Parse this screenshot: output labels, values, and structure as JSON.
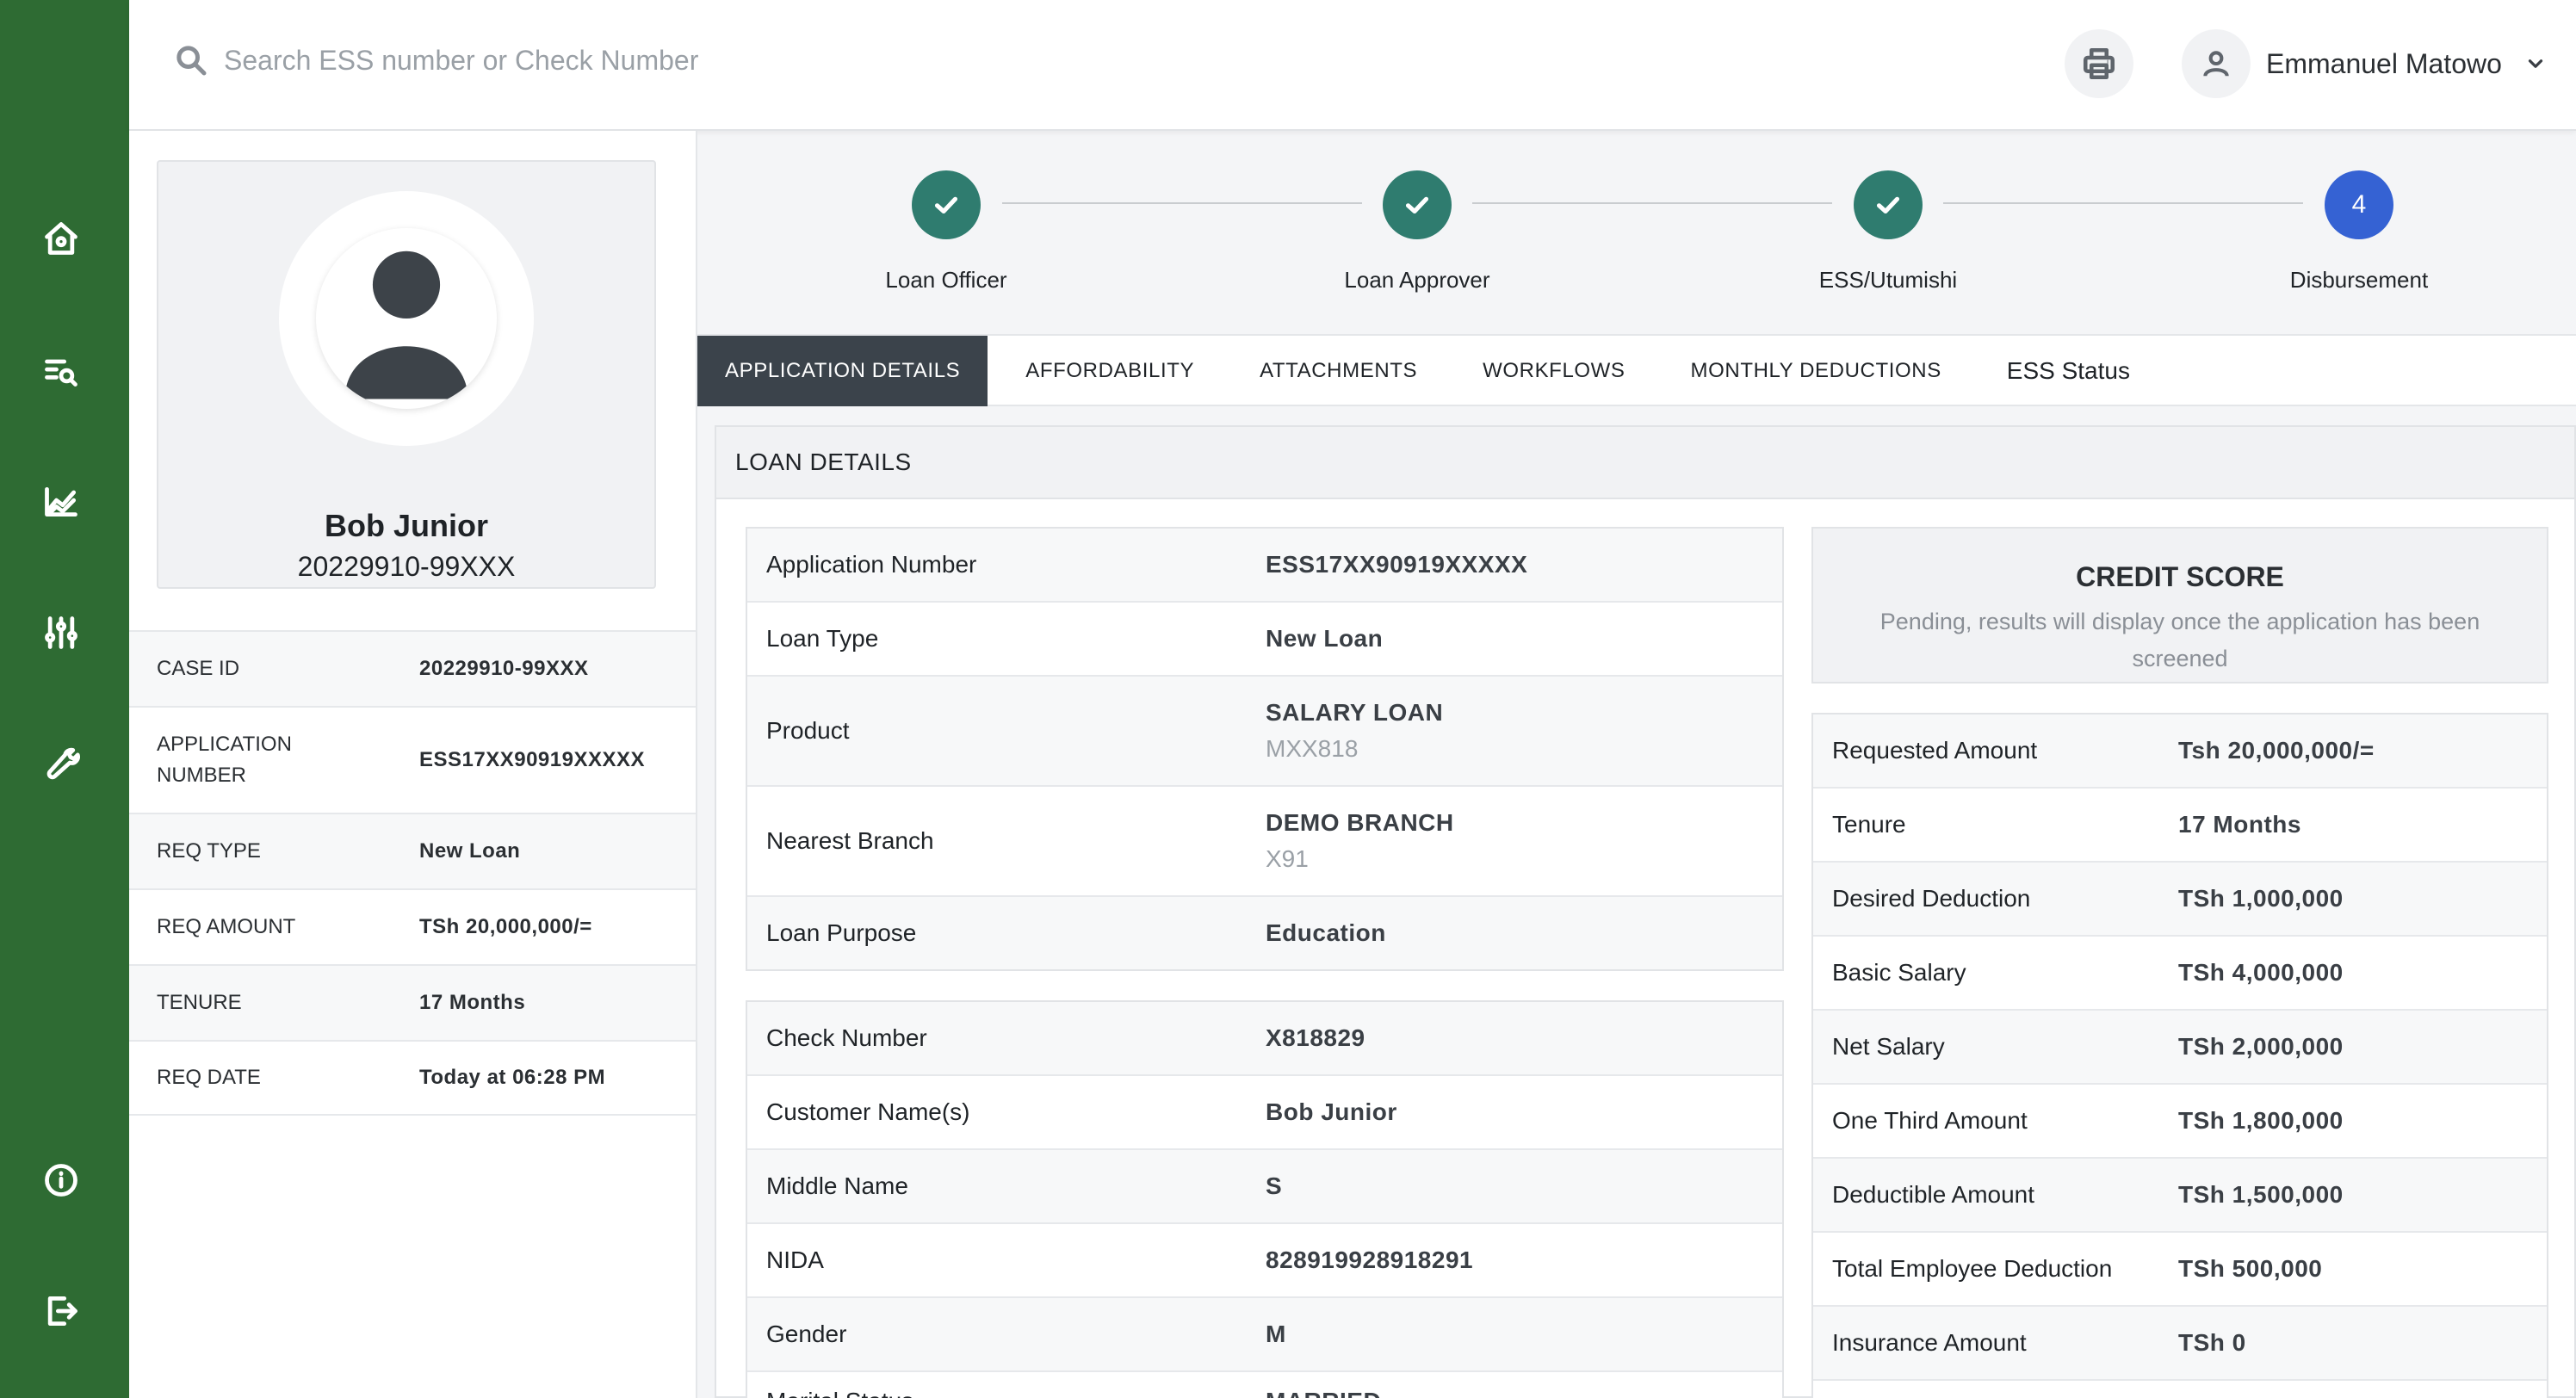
{
  "search": {
    "placeholder": "Search ESS number or Check Number"
  },
  "user": {
    "name": "Emmanuel Matowo"
  },
  "profile": {
    "name": "Bob Junior",
    "id": "20229910-99XXX"
  },
  "summary": [
    {
      "label": "CASE ID",
      "value": "20229910-99XXX"
    },
    {
      "label": "APPLICATION NUMBER",
      "value": "ESS17XX90919XXXXX"
    },
    {
      "label": "REQ TYPE",
      "value": "New Loan"
    },
    {
      "label": "REQ AMOUNT",
      "value": "TSh 20,000,000/="
    },
    {
      "label": "TENURE",
      "value": "17 Months"
    },
    {
      "label": "REQ DATE",
      "value": "Today at 06:28 PM"
    }
  ],
  "steps": [
    {
      "label": "Loan Officer",
      "state": "done"
    },
    {
      "label": "Loan Approver",
      "state": "done"
    },
    {
      "label": "ESS/Utumishi",
      "state": "done"
    },
    {
      "label": "Disbursement",
      "state": "active",
      "number": "4"
    }
  ],
  "tabs": [
    "APPLICATION DETAILS",
    "AFFORDABILITY",
    "ATTACHMENTS",
    "WORKFLOWS",
    "MONTHLY DEDUCTIONS",
    "ESS Status"
  ],
  "loan": {
    "title": "LOAN DETAILS",
    "details": [
      {
        "label": "Application Number",
        "value": "ESS17XX90919XXXXX"
      },
      {
        "label": "Loan Type",
        "value": "New Loan"
      },
      {
        "label": "Product",
        "value": "SALARY LOAN",
        "sub": "MXX818"
      },
      {
        "label": "Nearest Branch",
        "value": "DEMO BRANCH",
        "sub": "X91"
      },
      {
        "label": "Loan Purpose",
        "value": "Education"
      }
    ],
    "customer": [
      {
        "label": "Check Number",
        "value": "X818829"
      },
      {
        "label": "Customer Name(s)",
        "value": "Bob Junior"
      },
      {
        "label": "Middle Name",
        "value": "S"
      },
      {
        "label": "NIDA",
        "value": "828919928918291"
      },
      {
        "label": "Gender",
        "value": "M"
      },
      {
        "label": "Marital Status",
        "value": "MARRIED"
      }
    ],
    "credit": {
      "title": "CREDIT SCORE",
      "text": "Pending, results will display once the application has been screened"
    },
    "amounts": [
      {
        "label": "Requested Amount",
        "value": "Tsh 20,000,000/="
      },
      {
        "label": "Tenure",
        "value": "17 Months"
      },
      {
        "label": "Desired Deduction",
        "value": "TSh 1,000,000"
      },
      {
        "label": "Basic Salary",
        "value": "TSh 4,000,000"
      },
      {
        "label": "Net Salary",
        "value": "TSh 2,000,000"
      },
      {
        "label": "One Third Amount",
        "value": "TSh 1,800,000"
      },
      {
        "label": "Deductible Amount",
        "value": "TSh 1,500,000"
      },
      {
        "label": "Total Employee Deduction",
        "value": "TSh 500,000"
      },
      {
        "label": "Insurance Amount",
        "value": "TSh 0"
      },
      {
        "label": "",
        "value": ""
      }
    ]
  },
  "colors": {
    "sidebar": "#2e6b33",
    "step_done": "#2f7c6f",
    "step_active": "#3562d3",
    "tab_active": "#3b434b"
  },
  "icons": {
    "sidebar": [
      "home-icon",
      "list-search-icon",
      "analytics-icon",
      "sliders-icon",
      "wrench-icon",
      "info-icon",
      "logout-icon"
    ]
  }
}
